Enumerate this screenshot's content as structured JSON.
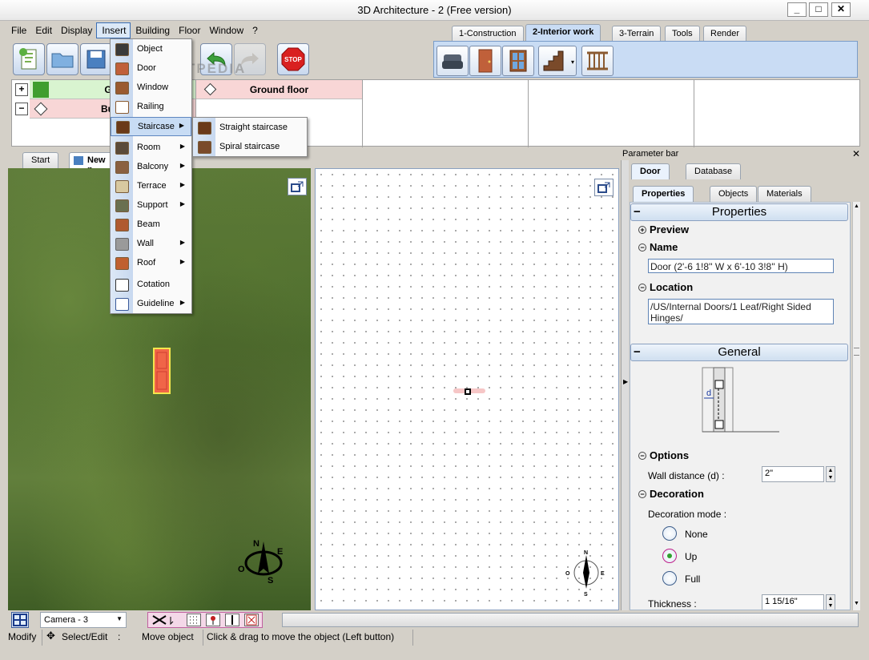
{
  "window": {
    "title": "3D Architecture - 2 (Free version)",
    "minimize": "_",
    "maximize": "□",
    "close": "✕"
  },
  "menu": [
    "File",
    "Edit",
    "Display",
    "Insert",
    "Building",
    "Floor",
    "Window",
    "?"
  ],
  "mode_tabs": [
    "1-Construction",
    "2-Interior work",
    "3-Terrain",
    "Tools",
    "Render"
  ],
  "floors": {
    "row1_label": "Gro",
    "row2_label": "Build",
    "current": "Ground floor",
    "plus": "+",
    "minus": "−"
  },
  "watermark": "SOFTPEDIA",
  "view_tabs": [
    "Start",
    "New p"
  ],
  "insert_menu": [
    {
      "label": "Object",
      "arrow": ""
    },
    {
      "label": "Door",
      "arrow": ""
    },
    {
      "label": "Window",
      "arrow": ""
    },
    {
      "label": "Railing",
      "arrow": ""
    },
    {
      "label": "Staircase",
      "arrow": "▶"
    },
    {
      "label": "Room",
      "arrow": "▶"
    },
    {
      "label": "Balcony",
      "arrow": "▶"
    },
    {
      "label": "Terrace",
      "arrow": "▶"
    },
    {
      "label": "Support",
      "arrow": "▶"
    },
    {
      "label": "Beam",
      "arrow": ""
    },
    {
      "label": "Wall",
      "arrow": "▶"
    },
    {
      "label": "Roof",
      "arrow": "▶"
    },
    {
      "label": "Cotation",
      "arrow": ""
    },
    {
      "label": "Guideline",
      "arrow": "▶"
    }
  ],
  "staircase_submenu": [
    "Straight staircase",
    "Spiral staircase"
  ],
  "compass": {
    "n": "N",
    "e": "E",
    "s": "S",
    "o": "O"
  },
  "parameter_bar": {
    "title": "Parameter bar",
    "close": "✕",
    "tabs": [
      "Door",
      "Database"
    ],
    "subtabs": [
      "Properties",
      "Objects",
      "Materials"
    ],
    "properties_header": "Properties",
    "preview": "Preview",
    "name_label": "Name",
    "name_value": "Door (2'-6 1!8'' W x 6'-10 3!8'' H)",
    "location_label": "Location",
    "location_value": "/US/Internal Doors/1 Leaf/Right Sided Hinges/",
    "general_header": "General",
    "diagram_label": "d",
    "options_label": "Options",
    "wall_distance_label": "Wall distance (d) :",
    "wall_distance_value": "2\"",
    "decoration_label": "Decoration",
    "decoration_mode_label": "Decoration mode :",
    "decoration_options": [
      "None",
      "Up",
      "Full"
    ],
    "decoration_selected": "Up",
    "thickness_label": "Thickness :",
    "thickness_value": "1 15/16\""
  },
  "camera": "Camera - 3",
  "status": {
    "mode": "Modify",
    "tool": "Select/Edit",
    "colon": ":",
    "action": "Move object",
    "hint": "Click & drag to move the object (Left button)"
  }
}
